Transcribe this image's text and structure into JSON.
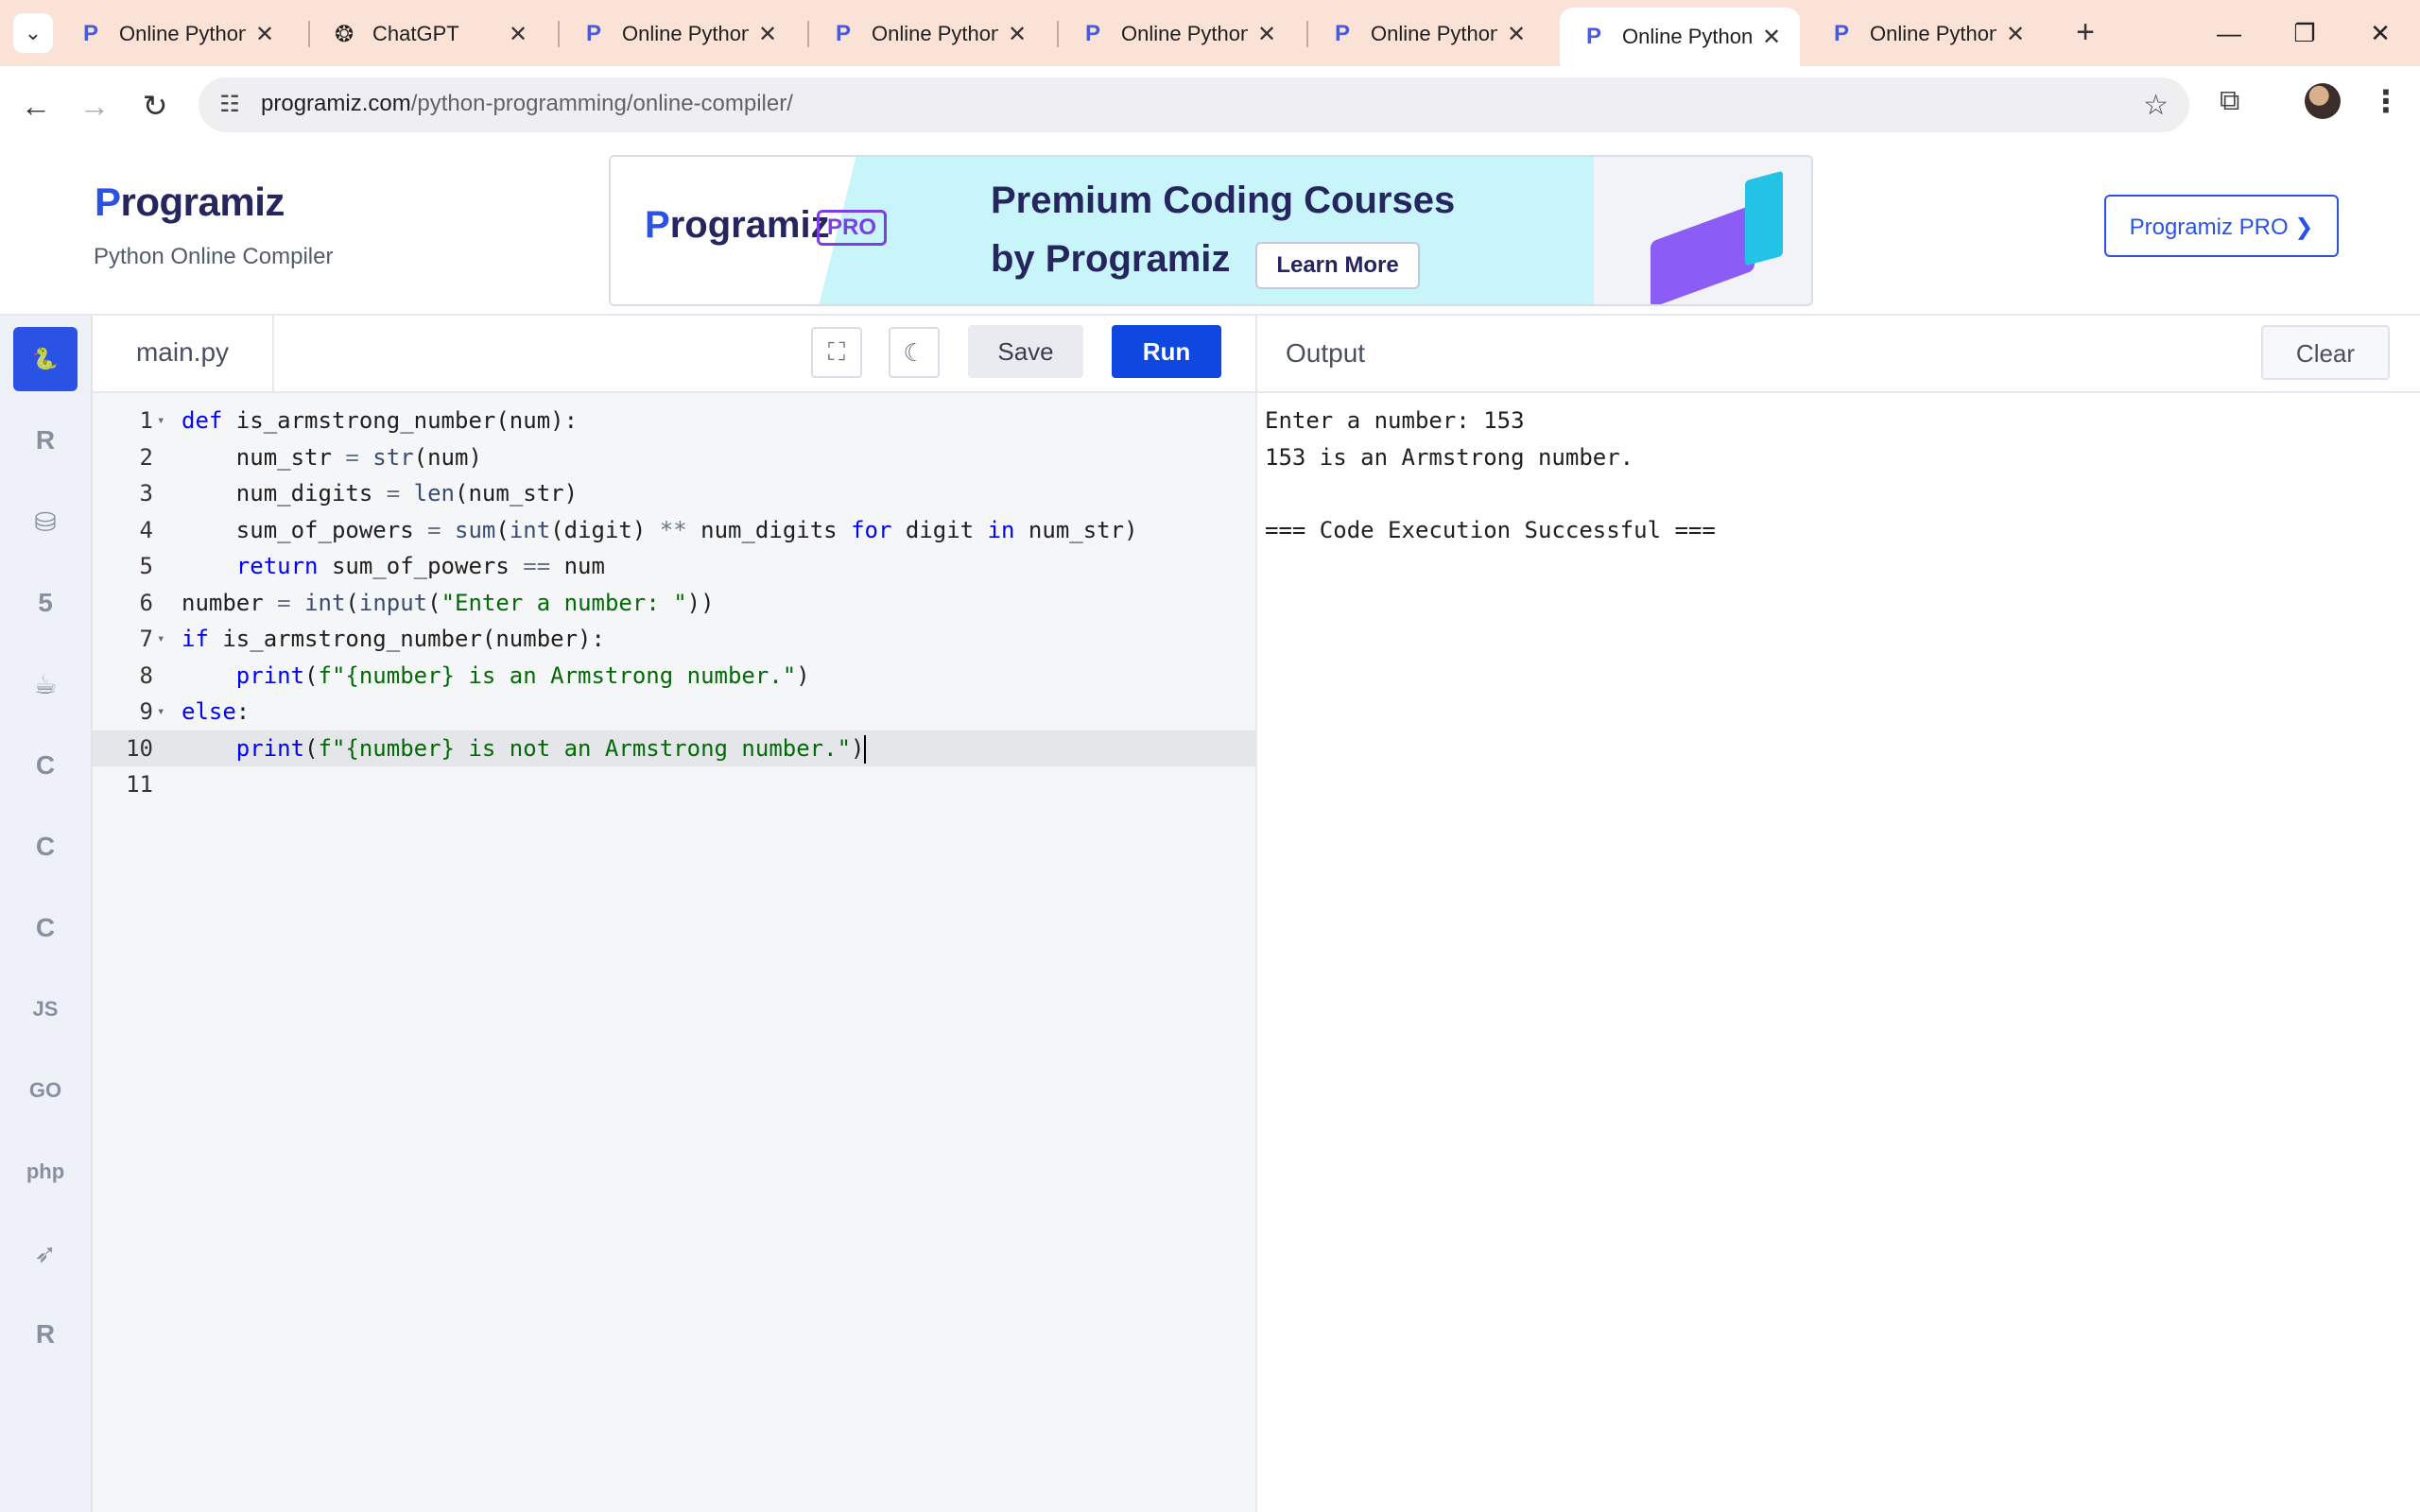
{
  "browser": {
    "tabs": [
      {
        "title": "Online Python",
        "icon": "programiz-icon"
      },
      {
        "title": "ChatGPT",
        "icon": "chatgpt-icon"
      },
      {
        "title": "Online Python",
        "icon": "programiz-icon"
      },
      {
        "title": "Online Python",
        "icon": "programiz-icon"
      },
      {
        "title": "Online Python",
        "icon": "programiz-icon"
      },
      {
        "title": "Online Python",
        "icon": "programiz-icon"
      },
      {
        "title": "Online Python",
        "icon": "programiz-icon",
        "active": true
      },
      {
        "title": "Online Python",
        "icon": "programiz-icon"
      }
    ],
    "url_host": "programiz.com",
    "url_path": "/python-programming/online-compiler/"
  },
  "site": {
    "logo_first": "P",
    "logo_rest": "rogramiz",
    "subtitle": "Python Online Compiler",
    "ad": {
      "logo_first": "P",
      "logo_rest": "rogramiz",
      "pro_badge": "PRO",
      "headline1": "Premium Coding Courses",
      "headline2": "by Programiz",
      "cta": "Learn More"
    },
    "pro_button": "Programiz PRO ❯"
  },
  "rail": {
    "items": [
      {
        "name": "python",
        "glyph": "🐍",
        "active": true
      },
      {
        "name": "r",
        "glyph": "R"
      },
      {
        "name": "sql",
        "glyph": "⛁"
      },
      {
        "name": "html",
        "glyph": "5"
      },
      {
        "name": "java",
        "glyph": "☕"
      },
      {
        "name": "c",
        "glyph": "C"
      },
      {
        "name": "cpp",
        "glyph": "C"
      },
      {
        "name": "csharp",
        "glyph": "C"
      },
      {
        "name": "js",
        "glyph": "JS"
      },
      {
        "name": "go",
        "glyph": "GO"
      },
      {
        "name": "php",
        "glyph": "php"
      },
      {
        "name": "swift",
        "glyph": "➶"
      },
      {
        "name": "rust",
        "glyph": "R"
      }
    ]
  },
  "editor": {
    "file_name": "main.py",
    "save_label": "Save",
    "run_label": "Run",
    "lines": [
      {
        "n": "1",
        "fold": true,
        "html": "<span style=\"color:#0000ff\">def</span> is_armstrong_number(num):"
      },
      {
        "n": "2",
        "html": "    num_str <span style=\"color:#687687\">=</span> <span style=\"color:#3c4c72\">str</span>(num)"
      },
      {
        "n": "3",
        "html": "    num_digits <span style=\"color:#687687\">=</span> <span style=\"color:#3c4c72\">len</span>(num_str)"
      },
      {
        "n": "4",
        "html": "    sum_of_powers <span style=\"color:#687687\">=</span> <span style=\"color:#3c4c72\">sum</span>(<span style=\"color:#3c4c72\">int</span>(digit) <span style=\"color:#687687\">**</span> num_digits <span style=\"color:#0000ff\">for</span> digit <span style=\"color:#0000ff\">in</span> num_str)"
      },
      {
        "n": "5",
        "html": "    <span style=\"color:#0000ff\">return</span> sum_of_powers <span style=\"color:#687687\">==</span> num"
      },
      {
        "n": "6",
        "html": "number <span style=\"color:#687687\">=</span> <span style=\"color:#3c4c72\">int</span>(<span style=\"color:#3c4c72\">input</span>(<span style=\"color:#036a07\">\"Enter a number: \"</span>))"
      },
      {
        "n": "7",
        "fold": true,
        "html": "<span style=\"color:#0000ff\">if</span> is_armstrong_number(number):"
      },
      {
        "n": "8",
        "html": "    <span style=\"color:#0000ff\">print</span>(<span style=\"color:#036a07\">f\"{number} is an Armstrong number.\"</span>)"
      },
      {
        "n": "9",
        "fold": true,
        "html": "<span style=\"color:#0000ff\">else</span>:"
      },
      {
        "n": "10",
        "current": true,
        "html": "    <span style=\"color:#0000ff\">print</span>(<span style=\"color:#036a07\">f\"{number} is not an Armstrong number.\"</span>)<span class=\"cursor\"></span>"
      },
      {
        "n": "11",
        "html": ""
      }
    ]
  },
  "output": {
    "title": "Output",
    "clear_label": "Clear",
    "lines": [
      "Enter a number: 153",
      "153 is an Armstrong number.",
      "",
      "=== Code Execution Successful ==="
    ]
  }
}
